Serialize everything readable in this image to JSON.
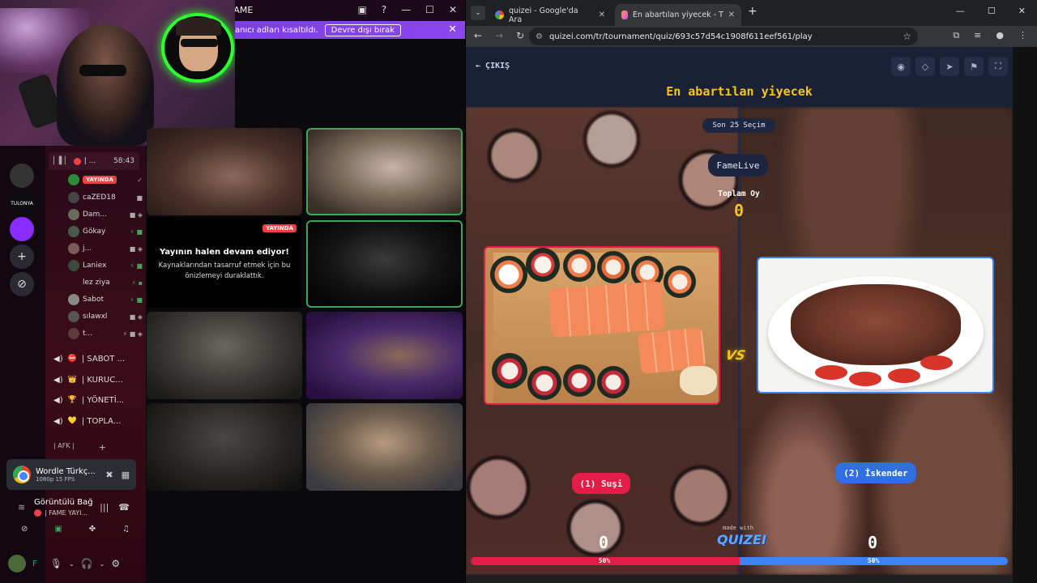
{
  "discord": {
    "titlebar": {
      "title": "FAME",
      "back": "←",
      "forward": "→"
    },
    "notice": {
      "text": "anıcı adları kısaltıldı.",
      "button": "Devre dışı bırak",
      "close": "✕"
    },
    "voice_channel": {
      "name": "| ...",
      "time": "58:43"
    },
    "members": [
      {
        "name": "",
        "badge": "YAYINDA"
      },
      {
        "name": "caZED18"
      },
      {
        "name": "Dam..."
      },
      {
        "name": "Gökay"
      },
      {
        "name": "j..."
      },
      {
        "name": "Laniex"
      },
      {
        "name": "lez ziya"
      },
      {
        "name": "Sabot"
      },
      {
        "name": "sılawxl"
      },
      {
        "name": "t..."
      }
    ],
    "channels": [
      {
        "emoji": "⛔",
        "name": "| SABOT ..."
      },
      {
        "emoji": "👑",
        "name": "| KURUC..."
      },
      {
        "emoji": "🏆",
        "name": "| YÖNETİ..."
      },
      {
        "emoji": "💛",
        "name": "| TOPLA..."
      }
    ],
    "afk": "| AFK |",
    "server_labels": {
      "tulonya": "TULONYA"
    },
    "activity": {
      "title": "Wordle Türkç...",
      "subtitle": "1080p 15 FPS"
    },
    "voice_status": {
      "line1": "Görüntülü Bağ",
      "line2": "| FAME YAYI..."
    },
    "live_tile": {
      "badge": "YAYINDA",
      "heading": "Yayının halen devam ediyor!",
      "body": "Kaynaklarından tasarruf etmek için bu önizlemeyi duraklattık."
    }
  },
  "chrome": {
    "tabs": [
      {
        "title": "quizei - Google'da Ara",
        "icon": "google-favicon"
      },
      {
        "title": "En abartılan yiyecek - Tier List, E",
        "icon": "quizei-favicon",
        "active": true
      }
    ],
    "url": "quizei.com/tr/tournament/quiz/693c57d54c1908f611eef561/play"
  },
  "quiz": {
    "back_label": "ÇIKIŞ",
    "title": "En abartılan yiyecek",
    "round_label": "Son 25 Seçim",
    "streamer": "FameLive",
    "total_votes_label": "Toplam Oy",
    "total_votes": "0",
    "vs": "VS",
    "options": [
      {
        "label": "(1) Suşi",
        "score": "0",
        "percent": "50%",
        "share": 0.5,
        "color": "#e11d48"
      },
      {
        "label": "(2) İskender",
        "score": "0",
        "percent": "50%",
        "share": 0.5,
        "color": "#3b82f6"
      }
    ],
    "made_with": "made with",
    "brand": "QUIZEI"
  }
}
